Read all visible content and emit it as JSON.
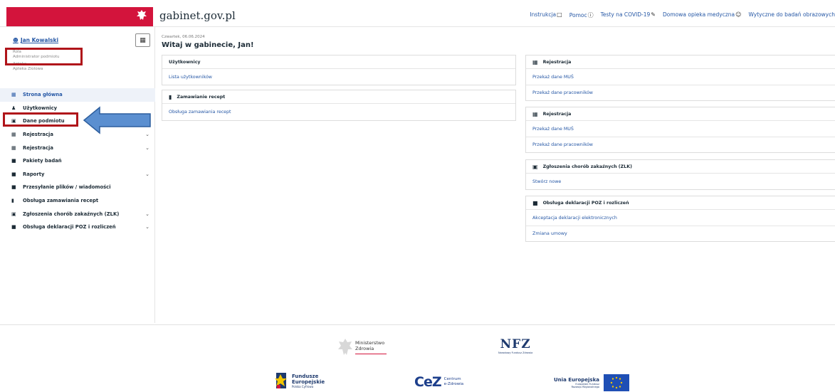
{
  "header": {
    "site_name": "gabinet.gov.pl",
    "nav": [
      {
        "label": "Instrukcja",
        "icon": "book-icon",
        "glyph": "□"
      },
      {
        "label": "Pomoc",
        "icon": "help-icon",
        "glyph": "ⓘ"
      },
      {
        "label": "Testy na COVID-19",
        "icon": "pencil-icon",
        "glyph": "✎"
      },
      {
        "label": "Domowa opieka medyczna",
        "icon": "people-icon",
        "glyph": "☺"
      },
      {
        "label": "Wytyczne do badań obrazowych",
        "icon": "",
        "glyph": ""
      }
    ]
  },
  "sidebar": {
    "user_name": "Jan Kowalski",
    "role_label": "Rola",
    "role_value": "Administrator podmiotu",
    "apteka_label": "Apteka",
    "apteka_value": "Apteka Ziolowa",
    "items": [
      {
        "label": "Strona główna",
        "icon": "grid-icon",
        "glyph": "▦",
        "chevron": false,
        "active": true
      },
      {
        "label": "Użytkownicy",
        "icon": "user-icon",
        "glyph": "♟",
        "chevron": false,
        "active": false
      },
      {
        "label": "Dane podmiotu",
        "icon": "building-icon",
        "glyph": "▣",
        "chevron": false,
        "active": false
      },
      {
        "label": "Rejestracja",
        "icon": "calendar-icon",
        "glyph": "▦",
        "chevron": true,
        "active": false
      },
      {
        "label": "Rejestracja",
        "icon": "calendar-icon",
        "glyph": "▦",
        "chevron": true,
        "active": false
      },
      {
        "label": "Pakiety badań",
        "icon": "document-icon",
        "glyph": "■",
        "chevron": false,
        "active": false
      },
      {
        "label": "Raporty",
        "icon": "document-icon",
        "glyph": "■",
        "chevron": true,
        "active": false
      },
      {
        "label": "Przesyłanie plików / wiadomości",
        "icon": "document-icon",
        "glyph": "■",
        "chevron": false,
        "active": false
      },
      {
        "label": "Obsługa zamawiania recept",
        "icon": "trash-icon",
        "glyph": "▮",
        "chevron": false,
        "active": false
      },
      {
        "label": "Zgłoszenia chorób zakaźnych (ZLK)",
        "icon": "clipboard-icon",
        "glyph": "▣",
        "chevron": true,
        "active": false
      },
      {
        "label": "Obsługa deklaracji POZ i rozliczeń",
        "icon": "document-icon",
        "glyph": "■",
        "chevron": true,
        "active": false
      }
    ]
  },
  "main": {
    "date": "Czwartek, 06.06.2024",
    "welcome": "Witaj w gabinecie, Jan!",
    "left_cards": [
      {
        "title": "Użytkownicy",
        "icon": "",
        "links": [
          "Lista użytkowników"
        ]
      },
      {
        "title": "Zamawianie recept",
        "icon": "trash-icon",
        "links": [
          "Obsługa zamawiania recept"
        ]
      }
    ],
    "right_cards": [
      {
        "title": "Rejestracja",
        "icon": "calendar-icon",
        "links": [
          "Przekaż dane MUŚ",
          "Przekaż dane pracowników"
        ]
      },
      {
        "title": "Rejestracja",
        "icon": "calendar-icon",
        "links": [
          "Przekaż dane MUŚ",
          "Przekaż dane pracowników"
        ]
      },
      {
        "title": "Zgłoszenia chorób zakaźnych (ZLK)",
        "icon": "clipboard-icon",
        "links": [
          "Stwórz nowe"
        ]
      },
      {
        "title": "Obsługa deklaracji POZ i rozliczeń",
        "icon": "document-icon",
        "links": [
          "Akceptacja deklaracji elektronicznych",
          "Zmiana umowy"
        ]
      }
    ]
  },
  "footer": {
    "mz_line1": "Ministerstwo",
    "mz_line2": "Zdrowia",
    "nfz": "NFZ",
    "nfz_sub": "Narodowy Fundusz Zdrowia",
    "fe_line1": "Fundusze",
    "fe_line2": "Europejskie",
    "fe_sub": "Polska Cyfrowa",
    "cez": "CeZ",
    "cez_line1": "Centrum",
    "cez_line2": "e-Zdrowia",
    "ue_line1": "Unia Europejska",
    "ue_sub1": "Europejski Fundusz",
    "ue_sub2": "Rozwoju Regionalnego"
  },
  "colors": {
    "brand_red": "#d3143c",
    "link_blue": "#2557a5",
    "annotation_red": "#b0141a",
    "arrow_blue": "#5b8fd0"
  }
}
